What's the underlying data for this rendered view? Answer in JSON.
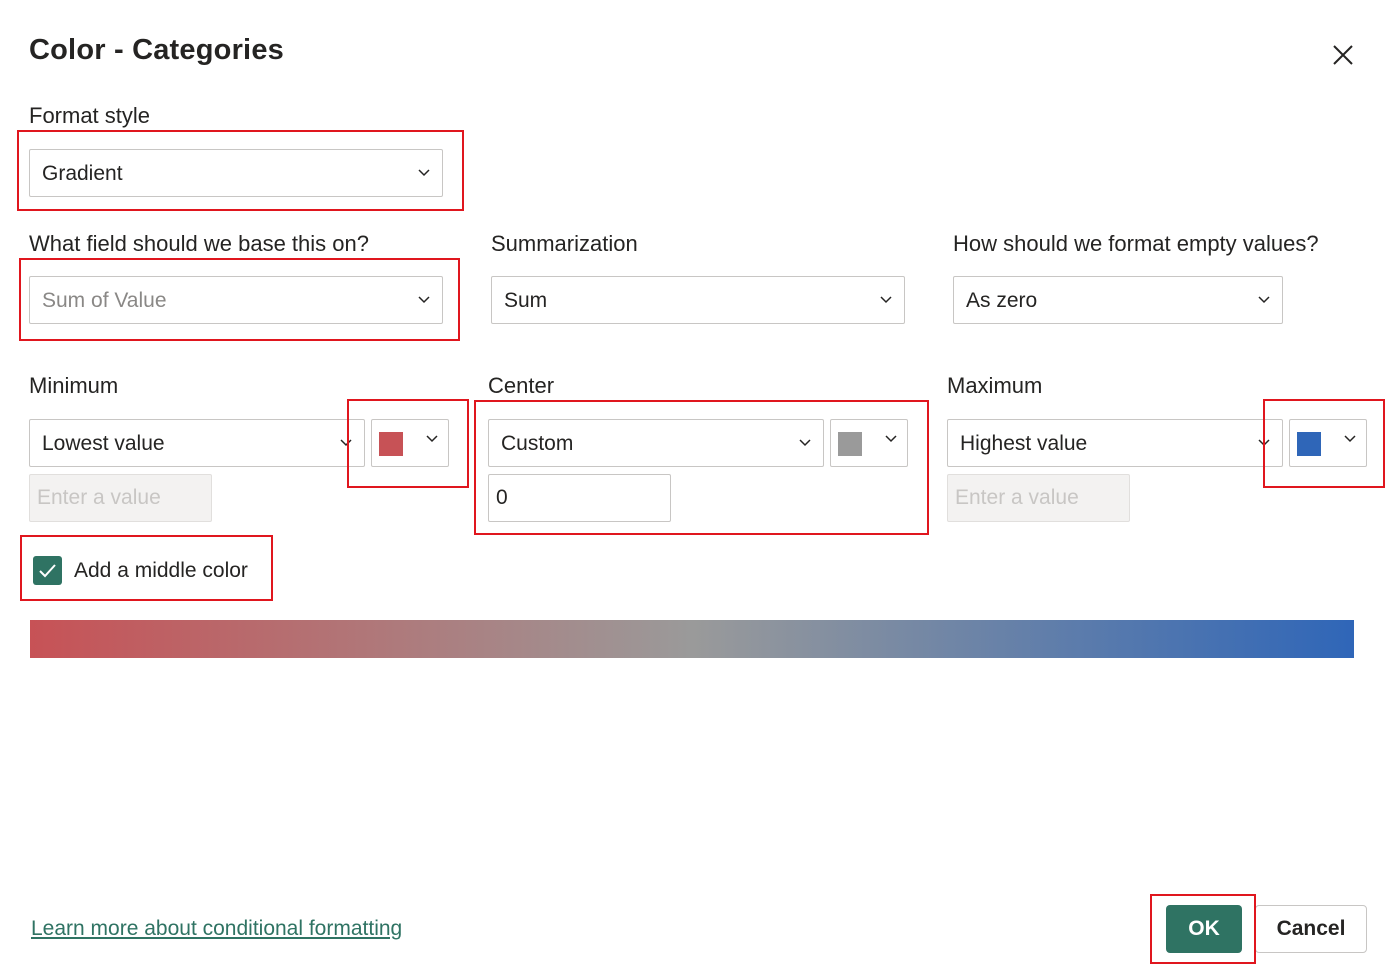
{
  "dialog": {
    "title": "Color - Categories",
    "close_icon": "close-icon"
  },
  "format_style": {
    "label": "Format style",
    "value": "Gradient"
  },
  "base_field": {
    "label": "What field should we base this on?",
    "value": "Sum of Value"
  },
  "summarization": {
    "label": "Summarization",
    "value": "Sum"
  },
  "empty_values": {
    "label": "How should we format empty values?",
    "value": "As zero"
  },
  "minimum": {
    "label": "Minimum",
    "value": "Lowest value",
    "color": "#c75256",
    "input_placeholder": "Enter a value"
  },
  "center": {
    "label": "Center",
    "value": "Custom",
    "color": "#9a9a9a",
    "input_value": "0"
  },
  "maximum": {
    "label": "Maximum",
    "value": "Highest value",
    "color": "#2f66b8",
    "input_placeholder": "Enter a value"
  },
  "middle_color": {
    "label": "Add a middle color",
    "checked": true
  },
  "gradient": {
    "start": "#c75256",
    "middle": "#9a9a9a",
    "end": "#2f66b8"
  },
  "footer": {
    "learn_more": "Learn more about conditional formatting",
    "ok": "OK",
    "cancel": "Cancel"
  },
  "colors": {
    "accent": "#2f7363",
    "highlight": "#e0161e"
  }
}
